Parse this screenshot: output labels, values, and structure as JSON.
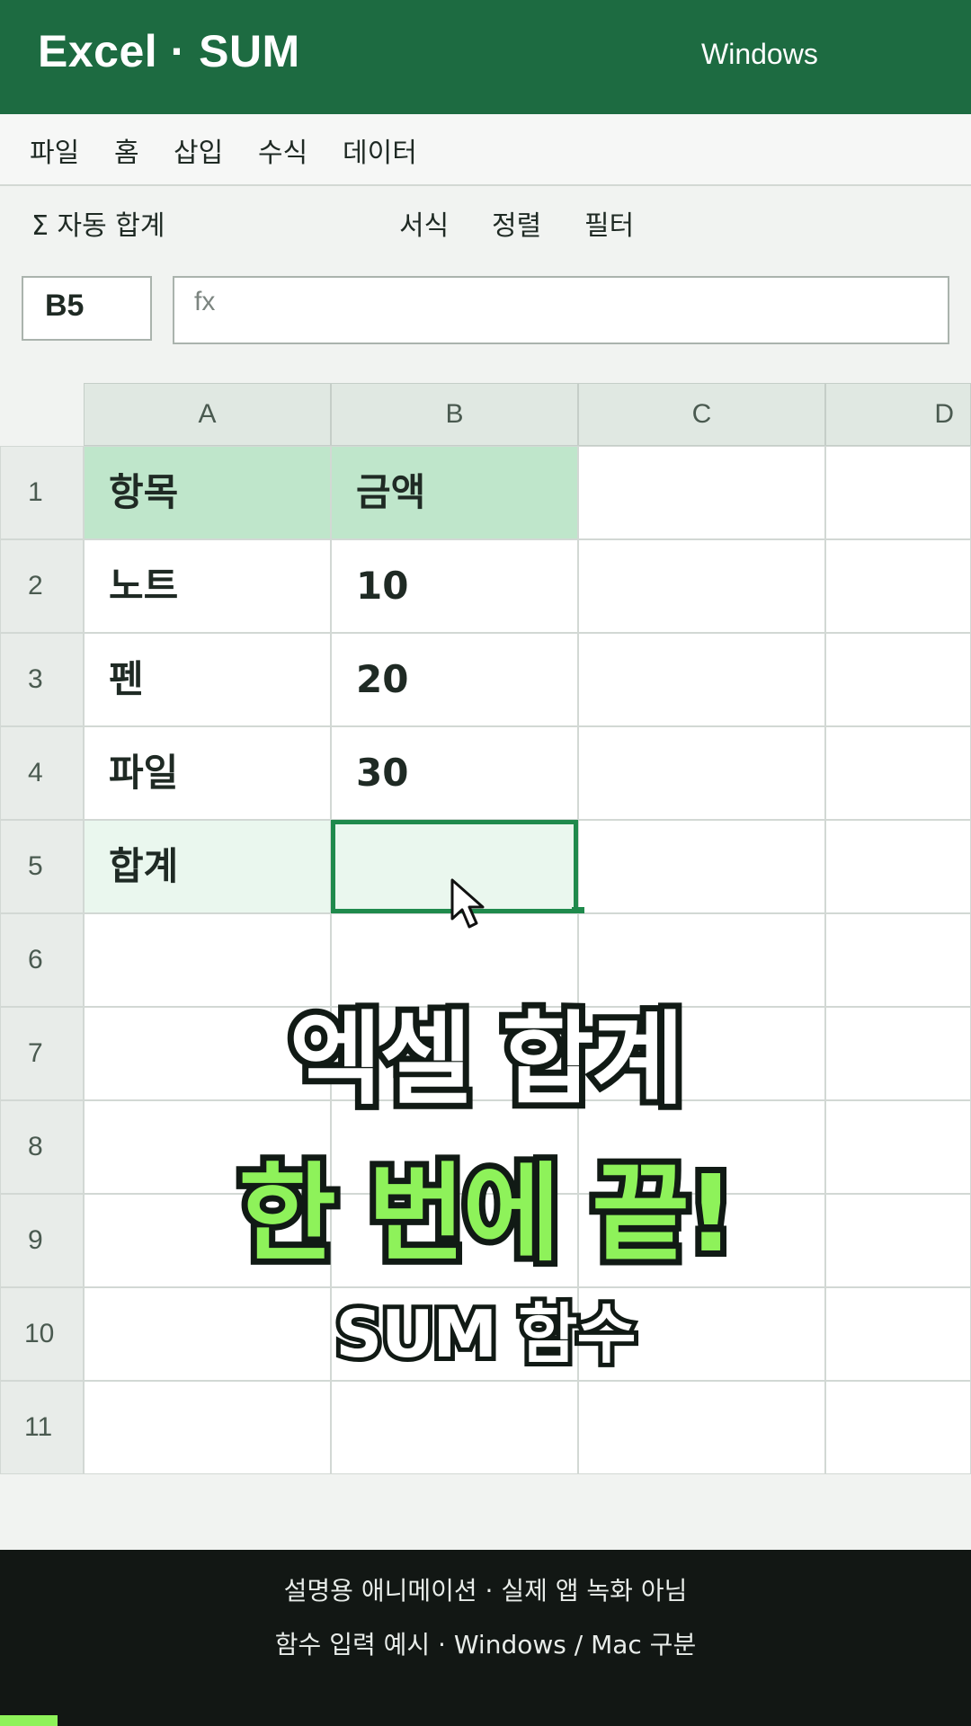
{
  "app": {
    "title": "Excel · SUM",
    "platform": "Windows"
  },
  "menu": {
    "items": [
      "파일",
      "홈",
      "삽입",
      "수식",
      "데이터"
    ]
  },
  "ribbon": {
    "autosum": "Σ 자동 합계",
    "format": "서식",
    "sort": "정렬",
    "filter": "필터"
  },
  "formula_bar": {
    "name_box": "B5",
    "fx_label": "fx",
    "value": ""
  },
  "sheet": {
    "columns": [
      "A",
      "B",
      "C",
      "D"
    ],
    "rows": [
      "1",
      "2",
      "3",
      "4",
      "5",
      "6",
      "7",
      "8",
      "9",
      "10",
      "11"
    ],
    "cells": {
      "A1": "항목",
      "B1": "금액",
      "A2": "노트",
      "B2": "10",
      "A3": "펜",
      "B3": "20",
      "A4": "파일",
      "B4": "30",
      "A5": "합계",
      "B5": ""
    },
    "selected_cell": "B5"
  },
  "overlay": {
    "line1": "엑셀 합계",
    "line2": "한 번에 끝!",
    "line3": "SUM 함수"
  },
  "footer": {
    "line1": "설명용 애니메이션 · 실제 앱 녹화 아님",
    "line2": "함수 입력 예시 · Windows / Mac 구분"
  },
  "colors": {
    "brand": "#1d6b41",
    "header_fill": "#bfe6cb",
    "selection": "#1f8a4c",
    "highlight": "#8ef25a"
  }
}
